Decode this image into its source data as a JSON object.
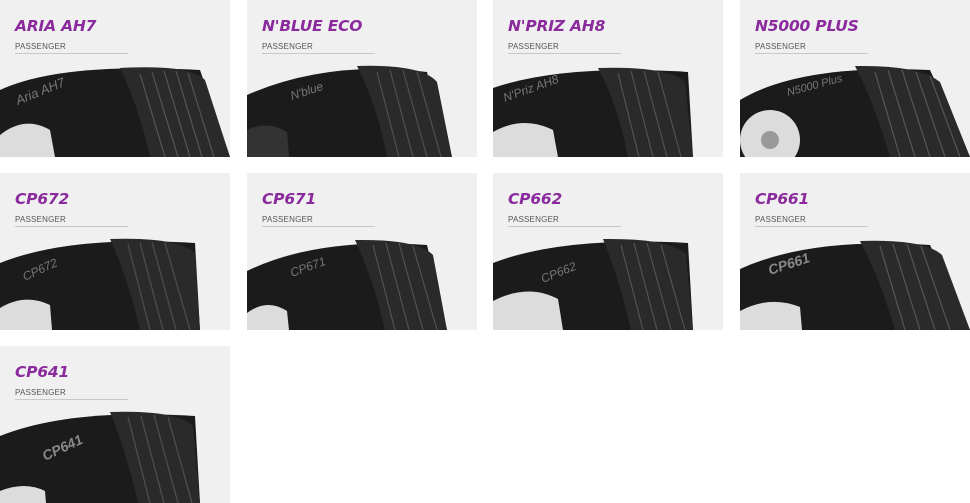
{
  "products": [
    {
      "name": "ARIA AH7",
      "category": "PASSENGER",
      "sidewall_text": "Aria AH7"
    },
    {
      "name": "N'BLUE ECO",
      "category": "PASSENGER",
      "sidewall_text": "N'blue"
    },
    {
      "name": "N'PRIZ AH8",
      "category": "PASSENGER",
      "sidewall_text": "N'Priz AH8"
    },
    {
      "name": "N5000 PLUS",
      "category": "PASSENGER",
      "sidewall_text": "N5000 Plus"
    },
    {
      "name": "CP672",
      "category": "PASSENGER",
      "sidewall_text": "CP672"
    },
    {
      "name": "CP671",
      "category": "PASSENGER",
      "sidewall_text": "CP671"
    },
    {
      "name": "CP662",
      "category": "PASSENGER",
      "sidewall_text": "CP662"
    },
    {
      "name": "CP661",
      "category": "PASSENGER",
      "sidewall_text": "CP661"
    },
    {
      "name": "CP641",
      "category": "PASSENGER",
      "sidewall_text": "CP641"
    }
  ],
  "colors": {
    "card_background": "#f0f0f0",
    "title": "#8a2a9c",
    "category": "#555555",
    "tire": "#222222"
  }
}
